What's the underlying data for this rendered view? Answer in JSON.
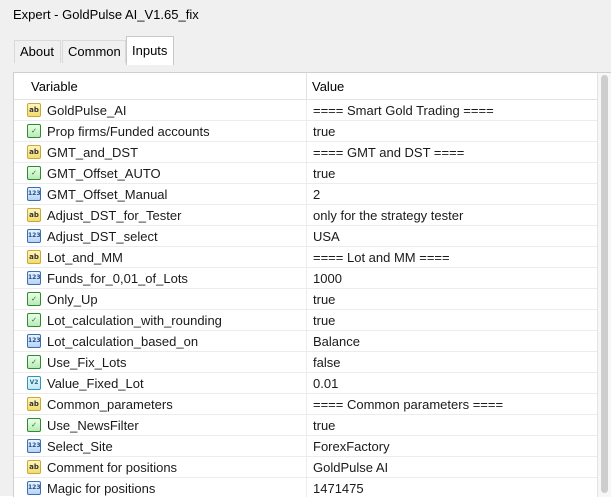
{
  "window": {
    "title": "Expert - GoldPulse AI_V1.65_fix"
  },
  "tabs": [
    {
      "label": "About",
      "active": false
    },
    {
      "label": "Common",
      "active": false
    },
    {
      "label": "Inputs",
      "active": true
    }
  ],
  "table": {
    "columns": {
      "variable": "Variable",
      "value": "Value"
    },
    "rows": [
      {
        "type": "string",
        "icon": "ab",
        "name": "GoldPulse_AI",
        "value": "==== Smart Gold Trading ===="
      },
      {
        "type": "bool",
        "icon": "bool",
        "name": "Prop firms/Funded accounts",
        "value": "true"
      },
      {
        "type": "string",
        "icon": "ab",
        "name": "GMT_and_DST",
        "value": "==== GMT and DST ===="
      },
      {
        "type": "bool",
        "icon": "bool",
        "name": "GMT_Offset_AUTO",
        "value": "true"
      },
      {
        "type": "int",
        "icon": "123",
        "name": "GMT_Offset_Manual",
        "value": "2"
      },
      {
        "type": "string",
        "icon": "ab",
        "name": "Adjust_DST_for_Tester",
        "value": "only for the strategy tester"
      },
      {
        "type": "int",
        "icon": "123",
        "name": "Adjust_DST_select",
        "value": "USA"
      },
      {
        "type": "string",
        "icon": "ab",
        "name": "Lot_and_MM",
        "value": "==== Lot and MM ===="
      },
      {
        "type": "int",
        "icon": "123",
        "name": "Funds_for_0,01_of_Lots",
        "value": "1000"
      },
      {
        "type": "bool",
        "icon": "bool",
        "name": "Only_Up",
        "value": "true"
      },
      {
        "type": "bool",
        "icon": "bool",
        "name": "Lot_calculation_with_rounding",
        "value": "true"
      },
      {
        "type": "int",
        "icon": "123",
        "name": "Lot_calculation_based_on",
        "value": "Balance"
      },
      {
        "type": "bool",
        "icon": "bool",
        "name": "Use_Fix_Lots",
        "value": "false"
      },
      {
        "type": "double",
        "icon": "V2",
        "name": "Value_Fixed_Lot",
        "value": "0.01"
      },
      {
        "type": "string",
        "icon": "ab",
        "name": "Common_parameters",
        "value": "==== Common parameters ===="
      },
      {
        "type": "bool",
        "icon": "bool",
        "name": "Use_NewsFilter",
        "value": "true"
      },
      {
        "type": "int",
        "icon": "123",
        "name": "Select_Site",
        "value": "ForexFactory"
      },
      {
        "type": "string",
        "icon": "ab",
        "name": "Comment for positions",
        "value": "GoldPulse AI"
      },
      {
        "type": "int",
        "icon": "123",
        "name": "Magic for positions",
        "value": "1471475"
      }
    ]
  }
}
